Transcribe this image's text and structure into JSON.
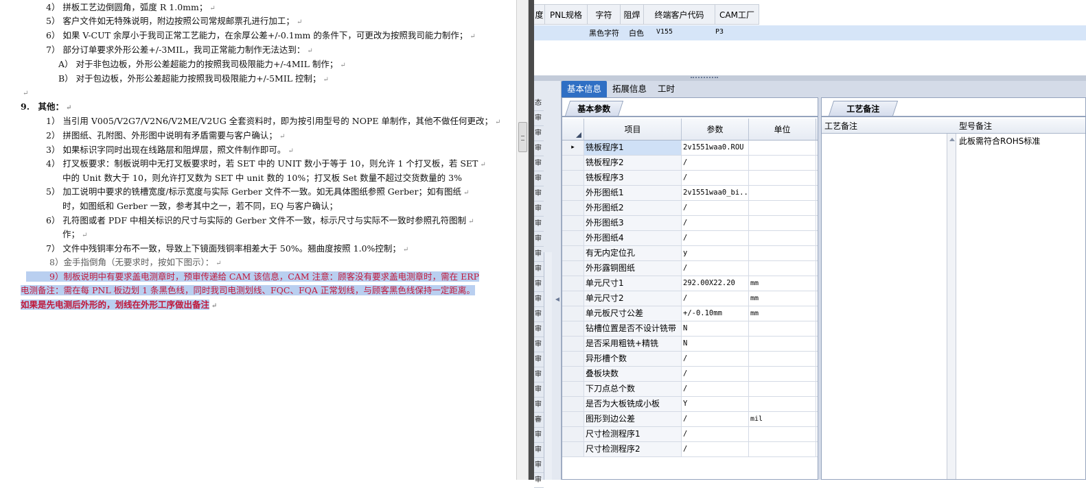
{
  "document": {
    "lines": [
      "4） 拼板工艺边倒圆角，弧度 R 1.0mm；",
      "5） 客户文件如无特殊说明，附边按照公司常规邮票孔进行加工；",
      "6） 如果 V-CUT 余厚小于我司正常工艺能力，在余厚公差+/-0.1mm 的条件下，可更改为按照我司能力制作；",
      "7） 部分订单要求外形公差+/-3MIL，我司正常能力制作无法达到：",
      "A） 对于非包边板，外形公差超能力的按照我司极限能力+/-4MIL 制作；",
      "B） 对于包边板，外形公差超能力按照我司极限能力+/-5MIL 控制；",
      "",
      "9.　其他：",
      "1） 当引用 V005/V2G7/V2N6/V2ME/V2UG 全套资料时，即为按引用型号的 NOPE 单制作，其他不做任何更改；",
      "2） 拼图纸、孔附图、外形图中说明有矛盾需要与客户确认；",
      "3） 如果标识字同时出现在线路层和阻焊层，照文件制作即可。",
      "4） 打叉板要求：制板说明中无打叉板要求时，若 SET 中的 UNIT 数小于等于 10，则允许 1 个打叉板，若 SET",
      "中的 Unit 数大于 10，则允许打叉数为 SET 中 unit 数的 10%；打叉板 Set 数量不超过交货数量的 3%",
      "5） 加工说明中要求的铣槽宽度/标示宽度与实际 Gerber 文件不一致。如无具体图纸参照 Gerber；如有图纸",
      "时，如图纸和 Gerber 一致，参考其中之一，若不同，EQ 与客户确认；",
      "6） 孔符图或者 PDF 中相关标识的尺寸与实际的 Gerber 文件不一致，标示尺寸与实际不一致时参照孔符图制",
      "作；",
      "7） 文件中残铜率分布不一致，导致上下镜面残铜率相差大于 50%。翘曲度按照 1.0%控制；",
      "8）金手指倒角（无要求时，按如下图示）：",
      "9）制板说明中有要求盖电测章时，预审传递给 CAM 该信息，CAM 注意：顾客没有要求盖电测章时，需在 ERP",
      "电测备注：需在每 PNL 板边划 1 条黑色线，同时我司电测划线、FQC、FQA 正常划线，与顾客黑色线保持一定距离。",
      "如果是先电测后外形的，划线在外形工序做出备注"
    ],
    "para_mark": "↵",
    "end_mark": "↵"
  },
  "top_grid": {
    "headers": [
      "度",
      "PNL规格",
      "字符",
      "阻焊",
      "终端客户代码",
      "CAM工厂"
    ],
    "row": {
      "char": "黑色字符",
      "mask": "白色",
      "code": "V155",
      "factory": "P3"
    }
  },
  "tabs": [
    "基本信息",
    "拓展信息",
    "工时"
  ],
  "left_strip": {
    "cells": [
      "态",
      "审",
      "审",
      "审",
      "审",
      "审",
      "审",
      "审",
      "审",
      "审",
      "审",
      "审",
      "审",
      "审",
      "审",
      "审",
      "审",
      "审",
      "审",
      "审",
      "审",
      "審",
      "审",
      "审",
      "审",
      "审"
    ]
  },
  "basic_params": {
    "tab": "基本参数",
    "headers": {
      "item": "项目",
      "param": "参数",
      "unit": "单位"
    },
    "current_row_marker": "▸",
    "rows": [
      {
        "item": "铣板程序1",
        "param": "2v1551waa0.ROU",
        "unit": ""
      },
      {
        "item": "铣板程序2",
        "param": "/",
        "unit": ""
      },
      {
        "item": "铣板程序3",
        "param": "/",
        "unit": ""
      },
      {
        "item": "外形图纸1",
        "param": "2v1551waa0_bi...",
        "unit": ""
      },
      {
        "item": "外形图纸2",
        "param": "/",
        "unit": ""
      },
      {
        "item": "外形图纸3",
        "param": "/",
        "unit": ""
      },
      {
        "item": "外形图纸4",
        "param": "/",
        "unit": ""
      },
      {
        "item": "有无内定位孔",
        "param": "y",
        "unit": ""
      },
      {
        "item": "外形露铜图纸",
        "param": "/",
        "unit": ""
      },
      {
        "item": "单元尺寸1",
        "param": "292.00X22.20",
        "unit": "mm"
      },
      {
        "item": "单元尺寸2",
        "param": "/",
        "unit": "mm"
      },
      {
        "item": "单元板尺寸公差",
        "param": "+/-0.10mm",
        "unit": "mm"
      },
      {
        "item": "钻槽位置是否不设计铣带",
        "param": "N",
        "unit": ""
      },
      {
        "item": "是否采用粗铣+精铣",
        "param": "N",
        "unit": ""
      },
      {
        "item": "异形槽个数",
        "param": "/",
        "unit": ""
      },
      {
        "item": "叠板块数",
        "param": "/",
        "unit": ""
      },
      {
        "item": "下刀点总个数",
        "param": "/",
        "unit": ""
      },
      {
        "item": "是否为大板铣成小板",
        "param": "Y",
        "unit": ""
      },
      {
        "item": "图形到边公差",
        "param": "/",
        "unit": "mil"
      },
      {
        "item": "尺寸检测程序1",
        "param": "/",
        "unit": ""
      },
      {
        "item": "尺寸检测程序2",
        "param": "/",
        "unit": ""
      }
    ]
  },
  "craft_notes": {
    "tab": "工艺备注",
    "col1": "工艺备注",
    "col2": "型号备注",
    "model_note": "此板需符合ROHS标准"
  }
}
